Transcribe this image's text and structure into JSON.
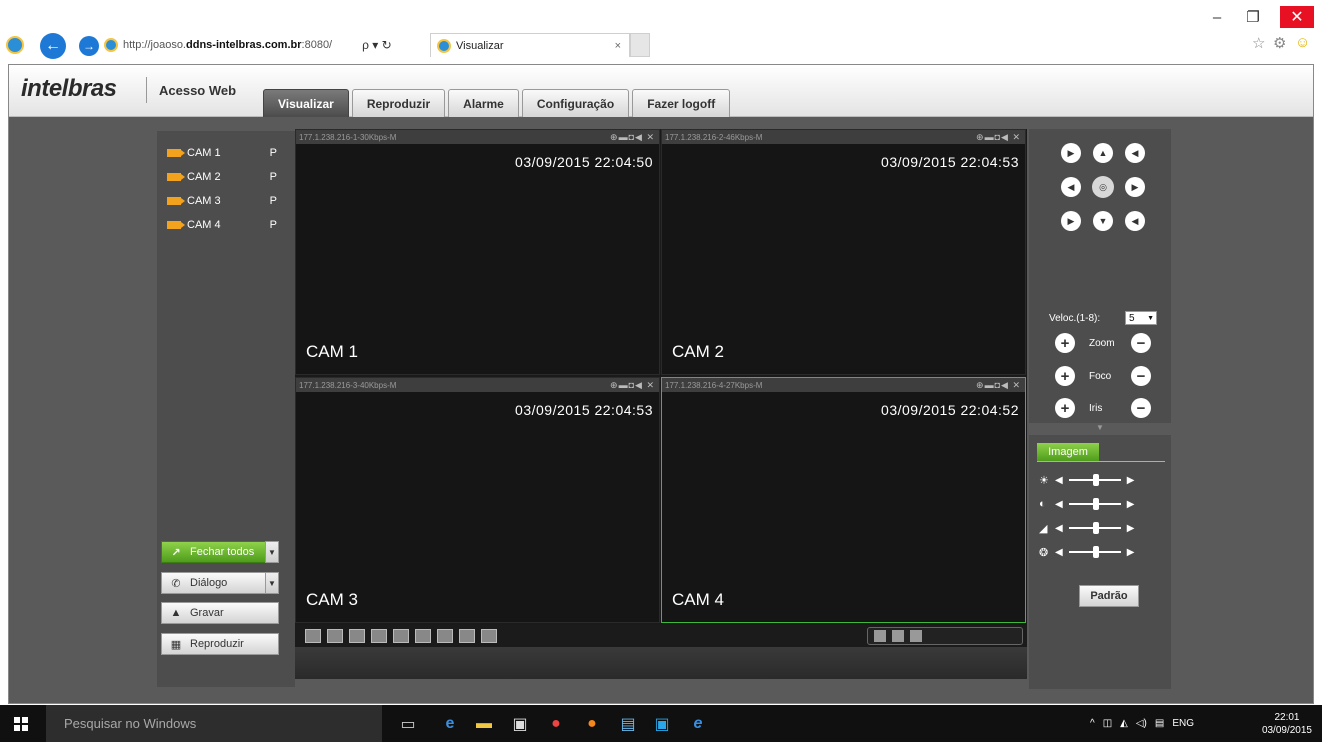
{
  "browser": {
    "url_prefix": "http://joaoso.",
    "url_domain": "ddns-intelbras.com.br",
    "url_suffix": ":8080/",
    "search_glyph": "ρ ▾ ↻",
    "tab_title": "Visualizar",
    "tab_close": "×",
    "win_min": "–",
    "win_restore": "❐",
    "win_close": "✕",
    "back_glyph": "←",
    "fwd_glyph": "→",
    "star_glyph": "☆",
    "gear_glyph": "⚙",
    "smiley_glyph": "☺"
  },
  "app": {
    "brand": "intelbras",
    "subtitle": "Acesso Web",
    "tabs": [
      {
        "label": "Visualizar",
        "active": true
      },
      {
        "label": "Reproduzir"
      },
      {
        "label": "Alarme"
      },
      {
        "label": "Configuração"
      },
      {
        "label": "Fazer logoff"
      }
    ]
  },
  "cameras": [
    {
      "name": "CAM 1",
      "flag": "P"
    },
    {
      "name": "CAM 2",
      "flag": "P"
    },
    {
      "name": "CAM 3",
      "flag": "P"
    },
    {
      "name": "CAM 4",
      "flag": "P"
    }
  ],
  "side_buttons": {
    "close_all": "Fechar todos",
    "dialog": "Diálogo",
    "record": "Gravar",
    "playback": "Reproduzir",
    "dropdown_glyph": "▼"
  },
  "cells": [
    {
      "info": "177.1.238.216-1-30Kbps-M",
      "timestamp": "03/09/2015 22:04:50",
      "label": "CAM 1",
      "icons": "⊕▬◘◀ ✕"
    },
    {
      "info": "177.1.238.216-2-46Kbps-M",
      "timestamp": "03/09/2015 22:04:53",
      "label": "CAM 2",
      "icons": "⊕▬◘◀ ✕"
    },
    {
      "info": "177.1.238.216-3-40Kbps-M",
      "timestamp": "03/09/2015 22:04:53",
      "label": "CAM 3",
      "icons": "⊕▬◘◀ ✕"
    },
    {
      "info": "177.1.238.216-4-27Kbps-M",
      "timestamp": "03/09/2015 22:04:52",
      "label": "CAM 4",
      "icons": "⊕▬◘◀ ✕"
    }
  ],
  "ptz": {
    "speed_label": "Veloc.(1-8):",
    "speed_value": "5",
    "zoom_label": "Zoom",
    "focus_label": "Foco",
    "iris_label": "Iris",
    "plus": "+",
    "minus": "−",
    "collapse_glyph": "▼",
    "arrows": [
      "▶",
      "▲",
      "◀",
      "◀",
      "◎",
      "▶",
      "▶",
      "▼",
      "◀"
    ]
  },
  "image": {
    "tab_label": "Imagem",
    "default_button": "Padrão",
    "slider_icons": [
      "☀",
      "◐",
      "◢",
      "❂"
    ],
    "left_glyph": "◀",
    "right_glyph": "▶"
  },
  "taskbar": {
    "search_placeholder": "Pesquisar no Windows",
    "tray_up": "^",
    "tray_lang": "ENG",
    "time": "22:01",
    "date": "03/09/2015"
  }
}
